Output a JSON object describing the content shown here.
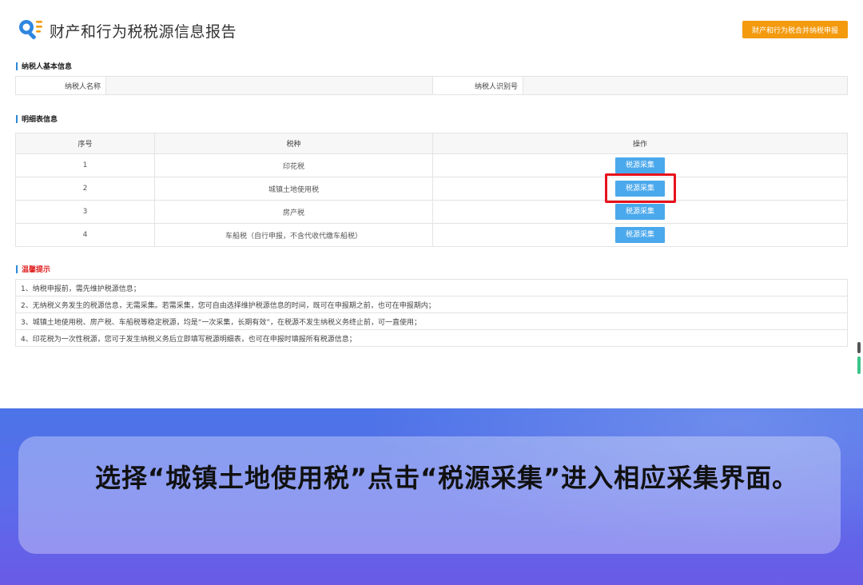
{
  "header": {
    "title": "财产和行为税税源信息报告",
    "logo_icon": "search-list-icon",
    "merge_button": "财产和行为税合并纳税申报"
  },
  "taxpayer": {
    "section_title": "纳税人基本信息",
    "name_label": "纳税人名称",
    "name_value": "",
    "id_label": "纳税人识别号",
    "id_value": ""
  },
  "details": {
    "section_title": "明细表信息",
    "columns": [
      "序号",
      "税种",
      "操作"
    ],
    "rows": [
      {
        "no": "1",
        "tax": "印花税",
        "action": "税源采集"
      },
      {
        "no": "2",
        "tax": "城镇土地使用税",
        "action": "税源采集"
      },
      {
        "no": "3",
        "tax": "房产税",
        "action": "税源采集"
      },
      {
        "no": "4",
        "tax": "车船税（自行申报，不含代收代缴车船税）",
        "action": "税源采集"
      }
    ]
  },
  "tips": {
    "section_title": "温馨提示",
    "items": [
      "1、纳税申报前，需先维护税源信息；",
      "2、无纳税义务发生的税源信息，无需采集。若需采集，您可自由选择维护税源信息的时间，既可在申报期之前，也可在申报期内；",
      "3、城镇土地使用税、房产税、车船税等稳定税源，均是“一次采集，长期有效”，在税源不发生纳税义务终止前，可一直使用；",
      "4、印花税为一次性税源，您可于发生纳税义务后立即填写税源明细表，也可在申报时填报所有税源信息；"
    ]
  },
  "caption": {
    "text": "选择“城镇土地使用税”点击“税源采集”进入相应采集界面。"
  },
  "colors": {
    "accent_blue": "#4aa8ec",
    "orange": "#f39a0e",
    "highlight_red": "#e8121a",
    "banner": "#5b6bea"
  }
}
